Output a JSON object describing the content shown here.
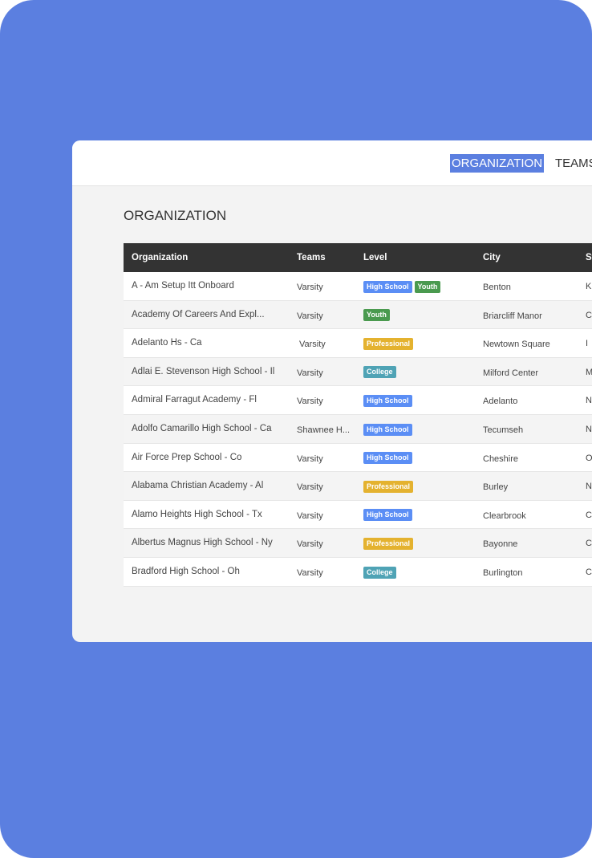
{
  "nav": {
    "active": "ORGANIZATION",
    "next": "TEAMS"
  },
  "page_title": "ORGANIZATION",
  "colors": {
    "background": "#5b7fe0",
    "High School": "#5b8ef5",
    "Youth": "#4a9a4f",
    "Professional": "#e4b22f",
    "College": "#4fa3b5"
  },
  "table": {
    "headers": [
      "Organization",
      "Teams",
      "Level",
      "City",
      "Sta"
    ],
    "rows": [
      {
        "org": "A - Am Setup Itt Onboard",
        "teams": "Varsity",
        "levels": [
          "High School",
          "Youth"
        ],
        "city": "Benton",
        "state": "K"
      },
      {
        "org": "Academy Of Careers And Expl...",
        "teams": "Varsity",
        "levels": [
          "Youth"
        ],
        "city": "Briarcliff Manor",
        "state": "C"
      },
      {
        "org": "Adelanto Hs - Ca",
        "teams": "Varsity",
        "levels": [
          "Professional"
        ],
        "city": "Newtown Square",
        "state": "I"
      },
      {
        "org": "Adlai E. Stevenson High School - Il",
        "teams": "Varsity",
        "levels": [
          "College"
        ],
        "city": "Milford Center",
        "state": "M"
      },
      {
        "org": "Admiral Farragut Academy - Fl",
        "teams": "Varsity",
        "levels": [
          "High School"
        ],
        "city": "Adelanto",
        "state": "N"
      },
      {
        "org": "Adolfo Camarillo High School - Ca",
        "teams": "Shawnee H...",
        "levels": [
          "High School"
        ],
        "city": "Tecumseh",
        "state": "N"
      },
      {
        "org": "Air Force Prep School - Co",
        "teams": "Varsity",
        "levels": [
          "High School"
        ],
        "city": "Cheshire",
        "state": "O"
      },
      {
        "org": "Alabama Christian Academy - Al",
        "teams": "Varsity",
        "levels": [
          "Professional"
        ],
        "city": "Burley",
        "state": "N"
      },
      {
        "org": "Alamo Heights High School - Tx",
        "teams": "Varsity",
        "levels": [
          "High School"
        ],
        "city": "Clearbrook",
        "state": "C"
      },
      {
        "org": "Albertus Magnus High School - Ny",
        "teams": "Varsity",
        "levels": [
          "Professional"
        ],
        "city": "Bayonne",
        "state": "C"
      },
      {
        "org": "Bradford High School - Oh",
        "teams": "Varsity",
        "levels": [
          "College"
        ],
        "city": "Burlington",
        "state": "C"
      }
    ]
  }
}
